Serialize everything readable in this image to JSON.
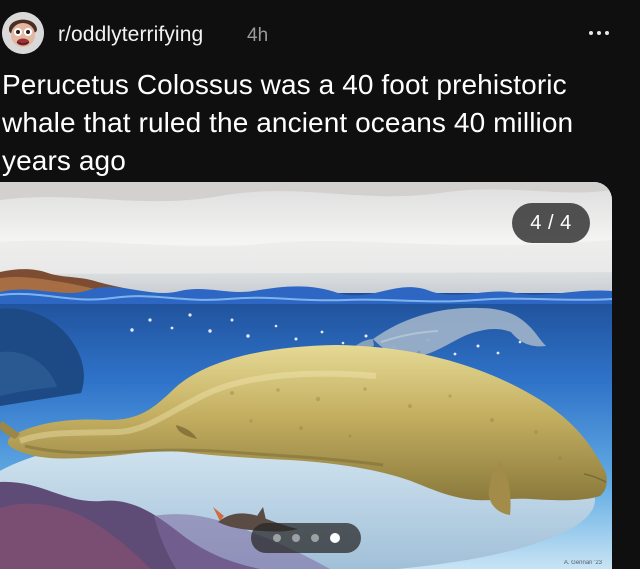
{
  "post": {
    "subreddit": "r/oddlyterrifying",
    "age": "4h",
    "title": "Perucetus Colossus was a 40 foot prehistoric whale that ruled the ancient oceans 40 million years ago"
  },
  "header": {
    "avatar_icon": "cartoon-avatar-icon",
    "more_icon": "more-options-icon"
  },
  "media": {
    "page_counter": "4 / 4",
    "dots": [
      {
        "state": "inactive"
      },
      {
        "state": "inactive"
      },
      {
        "state": "inactive"
      },
      {
        "state": "active"
      }
    ],
    "active_index": 4,
    "total": 4,
    "signature": "A. Gennari '23"
  },
  "colors": {
    "background": "#0f0f10",
    "text": "#ffffff",
    "secondary_text": "#9a9a9a",
    "counter_badge": "#363636"
  }
}
